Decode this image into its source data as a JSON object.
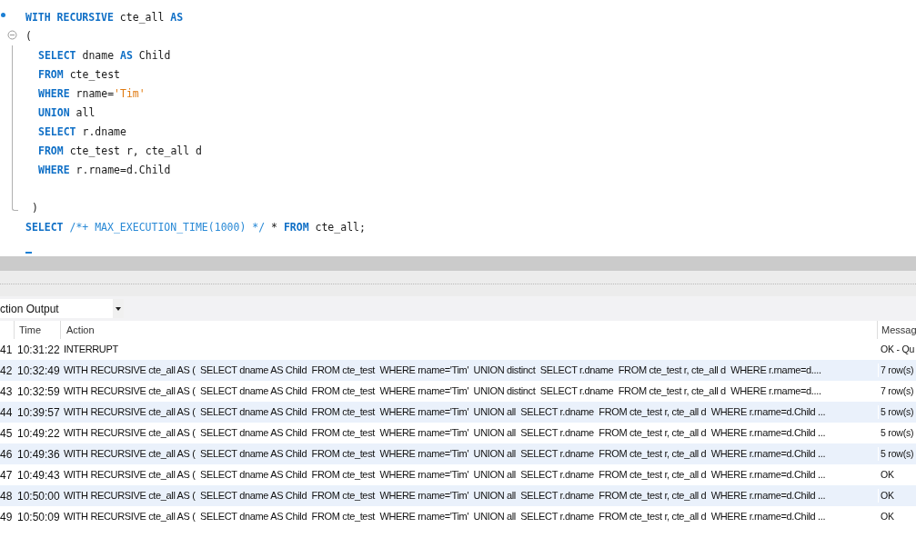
{
  "editor": {
    "lines": [
      {
        "marker": true,
        "fold": false,
        "tokens": [
          {
            "kind": "keyword",
            "text": "WITH RECURSIVE"
          },
          {
            "kind": "plain",
            "text": " cte_all "
          },
          {
            "kind": "keyword",
            "text": "AS"
          }
        ]
      },
      {
        "marker": false,
        "fold": true,
        "tokens": [
          {
            "kind": "plain",
            "text": "("
          }
        ],
        "close": ")",
        "children": [
          {
            "tokens": [
              {
                "kind": "keyword",
                "text": "SELECT"
              },
              {
                "kind": "plain",
                "text": " dname "
              },
              {
                "kind": "keyword",
                "text": "AS"
              },
              {
                "kind": "plain",
                "text": " Child"
              }
            ]
          },
          {
            "tokens": [
              {
                "kind": "keyword",
                "text": "FROM"
              },
              {
                "kind": "plain",
                "text": " cte_test"
              }
            ]
          },
          {
            "tokens": [
              {
                "kind": "keyword",
                "text": "WHERE"
              },
              {
                "kind": "plain",
                "text": " rname="
              },
              {
                "kind": "string",
                "text": "'Tim'"
              }
            ]
          },
          {
            "tokens": [
              {
                "kind": "keyword",
                "text": "UNION"
              },
              {
                "kind": "plain",
                "text": " all"
              }
            ]
          },
          {
            "tokens": [
              {
                "kind": "keyword",
                "text": "SELECT"
              },
              {
                "kind": "plain",
                "text": " r.dname"
              }
            ]
          },
          {
            "tokens": [
              {
                "kind": "keyword",
                "text": "FROM"
              },
              {
                "kind": "plain",
                "text": " cte_test r, cte_all d"
              }
            ]
          },
          {
            "tokens": [
              {
                "kind": "keyword",
                "text": "WHERE"
              },
              {
                "kind": "plain",
                "text": " r.rname=d.Child"
              }
            ]
          }
        ]
      },
      {
        "marker": false,
        "fold": false,
        "tokens": [
          {
            "kind": "keyword",
            "text": "SELECT"
          },
          {
            "kind": "comment",
            "text": " /*+ MAX_EXECUTION_TIME(1000) */"
          },
          {
            "kind": "plain",
            "text": " * "
          },
          {
            "kind": "keyword",
            "text": "FROM"
          },
          {
            "kind": "plain",
            "text": " cte_all;"
          }
        ]
      }
    ]
  },
  "output": {
    "selector": "ction Output",
    "columns": [
      "Time",
      "Action",
      "Messag"
    ],
    "rows": [
      {
        "index": "41",
        "time": "10:31:22",
        "action": "INTERRUPT",
        "message": "OK - Qu"
      },
      {
        "index": "42",
        "time": "10:32:49",
        "action": "WITH RECURSIVE cte_all AS (  SELECT dname AS Child  FROM cte_test  WHERE rname='Tim'  UNION distinct  SELECT r.dname  FROM cte_test r, cte_all d  WHERE r.rname=d....",
        "message": "7 row(s)"
      },
      {
        "index": "43",
        "time": "10:32:59",
        "action": "WITH RECURSIVE cte_all AS (  SELECT dname AS Child  FROM cte_test  WHERE rname='Tim'  UNION distinct  SELECT r.dname  FROM cte_test r, cte_all d  WHERE r.rname=d....",
        "message": "7 row(s)"
      },
      {
        "index": "44",
        "time": "10:39:57",
        "action": "WITH RECURSIVE cte_all AS (  SELECT dname AS Child  FROM cte_test  WHERE rname='Tim'  UNION all  SELECT r.dname  FROM cte_test r, cte_all d  WHERE r.rname=d.Child ...",
        "message": "5 row(s)"
      },
      {
        "index": "45",
        "time": "10:49:22",
        "action": "WITH RECURSIVE cte_all AS (  SELECT dname AS Child  FROM cte_test  WHERE rname='Tim'  UNION all  SELECT r.dname  FROM cte_test r, cte_all d  WHERE r.rname=d.Child ...",
        "message": "5 row(s)"
      },
      {
        "index": "46",
        "time": "10:49:36",
        "action": "WITH RECURSIVE cte_all AS (  SELECT dname AS Child  FROM cte_test  WHERE rname='Tim'  UNION all  SELECT r.dname  FROM cte_test r, cte_all d  WHERE r.rname=d.Child ...",
        "message": "5 row(s)"
      },
      {
        "index": "47",
        "time": "10:49:43",
        "action": "WITH RECURSIVE cte_all AS (  SELECT dname AS Child  FROM cte_test  WHERE rname='Tim'  UNION all  SELECT r.dname  FROM cte_test r, cte_all d  WHERE r.rname=d.Child ...",
        "message": "OK"
      },
      {
        "index": "48",
        "time": "10:50:00",
        "action": "WITH RECURSIVE cte_all AS (  SELECT dname AS Child  FROM cte_test  WHERE rname='Tim'  UNION all  SELECT r.dname  FROM cte_test r, cte_all d  WHERE r.rname=d.Child ...",
        "message": "OK"
      },
      {
        "index": "49",
        "time": "10:50:09",
        "action": "WITH RECURSIVE cte_all AS (  SELECT dname AS Child  FROM cte_test  WHERE rname='Tim'  UNION all  SELECT r.dname  FROM cte_test r, cte_all d  WHERE r.rname=d.Child ...",
        "message": "OK"
      }
    ]
  }
}
